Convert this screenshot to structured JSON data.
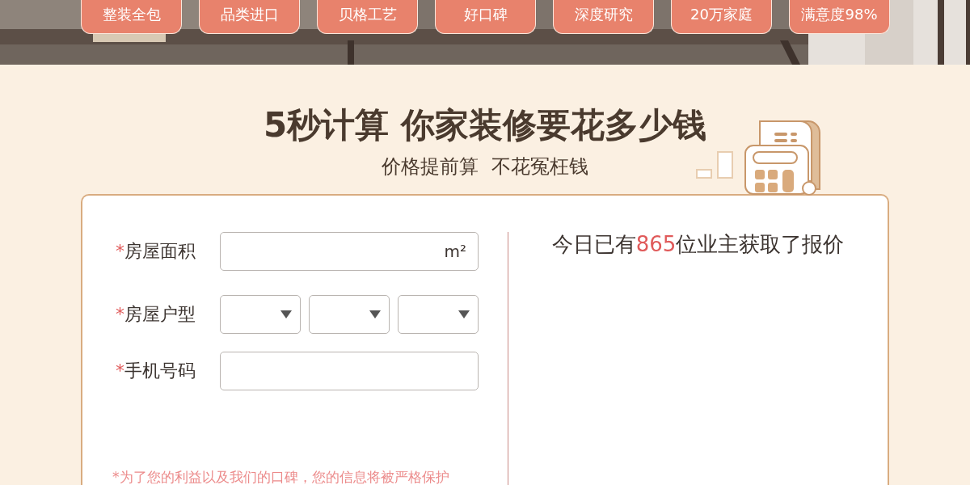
{
  "hero": {
    "kind": "picture",
    "tags": [
      {
        "label": "整装全包"
      },
      {
        "label": "品类进口"
      },
      {
        "label": "贝格工艺"
      },
      {
        "label": "好口碑"
      },
      {
        "label": "深度研究"
      },
      {
        "label": "20万家庭"
      },
      {
        "label": "满意度98%"
      }
    ]
  },
  "heading": {
    "title": "5秒计算 你家装修要花多少钱",
    "subtitle": "价格提前算  不花冤枉钱"
  },
  "form": {
    "fields": [
      {
        "kind": "text",
        "required_mark": "*",
        "label": "房屋面积",
        "unit": "m²"
      },
      {
        "kind": "selects",
        "required_mark": "*",
        "label": "房屋户型",
        "dropdowns": [
          {
            "kind": "dropdown"
          },
          {
            "kind": "dropdown"
          },
          {
            "kind": "dropdown"
          }
        ]
      },
      {
        "kind": "text",
        "required_mark": "*",
        "label": "手机号码"
      }
    ],
    "note": "*为了您的利益以及我们的口碑，您的信息将被严格保护"
  },
  "stats": {
    "prefix": "今日已有",
    "count": "865",
    "suffix": "位业主获取了报价"
  }
}
